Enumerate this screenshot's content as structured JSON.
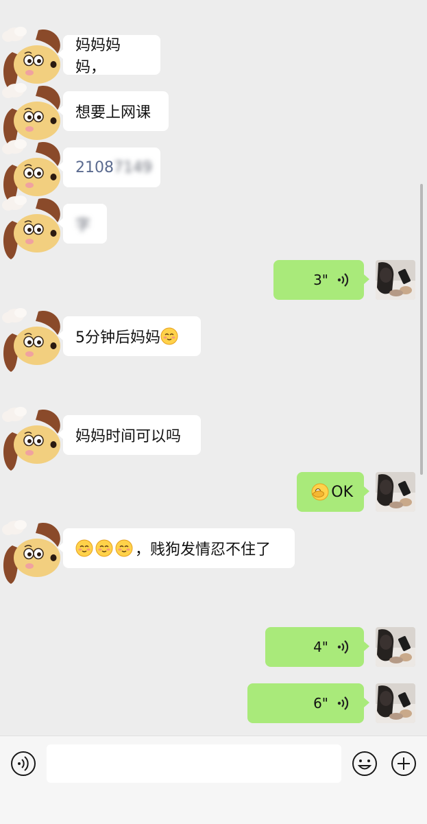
{
  "messages": [
    {
      "side": "left",
      "text": "妈妈妈妈，"
    },
    {
      "side": "left",
      "text": "想要上网课"
    },
    {
      "side": "left",
      "text": "2108",
      "blurred_suffix": "7149"
    },
    {
      "side": "left",
      "blurred": "字"
    },
    {
      "side": "right",
      "type": "voice",
      "duration": "3\""
    },
    {
      "side": "left",
      "text": "5分钟后妈妈"
    },
    {
      "side": "left",
      "text": "妈妈时间可以吗"
    },
    {
      "side": "right",
      "text": "OK"
    },
    {
      "side": "left",
      "text": "，贱狗发情忍不住了"
    },
    {
      "side": "right",
      "type": "voice",
      "duration": "4\""
    },
    {
      "side": "right",
      "type": "voice",
      "duration": "6\""
    }
  ],
  "colors": {
    "background": "#ededed",
    "bubble_left": "#ffffff",
    "bubble_right": "#a9ea7a",
    "input_bar": "#f6f6f6"
  },
  "icons": [
    "voice-input-icon",
    "emoji-icon",
    "plus-icon",
    "voice-waves-icon",
    "smiling-emoji-icon",
    "facepalm-emoji-icon"
  ]
}
